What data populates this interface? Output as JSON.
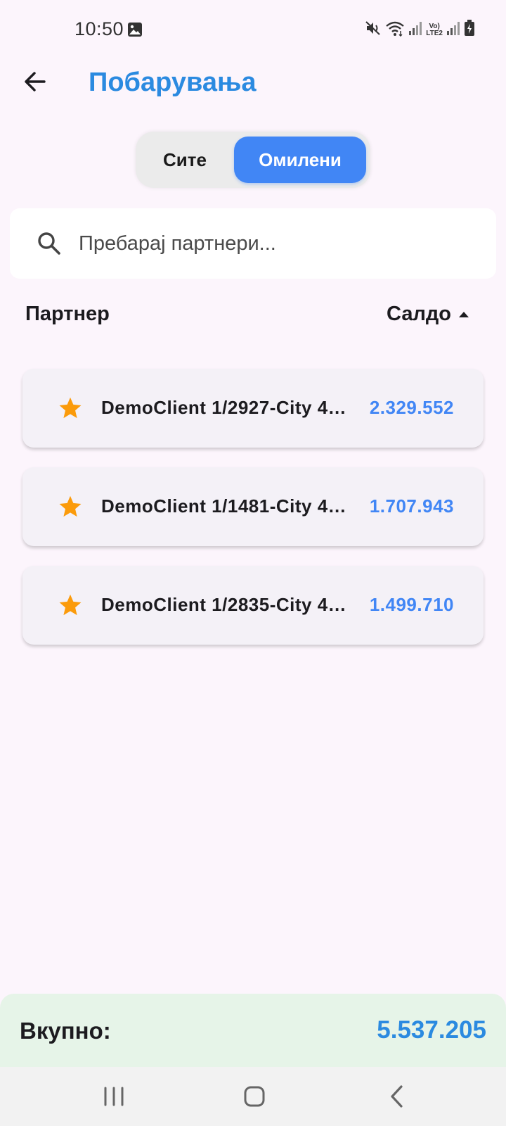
{
  "status_bar": {
    "time": "10:50",
    "volte_line1": "Vo)",
    "volte_line2": "LTE2"
  },
  "header": {
    "title": "Побарувања"
  },
  "filter_toggle": {
    "all_label": "Сите",
    "favorites_label": "Омилени",
    "selected": "favorites",
    "accent_color": "#4186f5"
  },
  "search": {
    "placeholder": "Пребарај партнери...",
    "value": ""
  },
  "columns": {
    "partner": "Партнер",
    "balance": "Салдо",
    "sort_icon": "sort-ascending-icon"
  },
  "partners": [
    {
      "name": "DemoClient 1/2927-City 4…",
      "balance": "2.329.552",
      "favorite": true
    },
    {
      "name": "DemoClient 1/1481-City 4…",
      "balance": "1.707.943",
      "favorite": true
    },
    {
      "name": "DemoClient 1/2835-City 4…",
      "balance": "1.499.710",
      "favorite": true
    }
  ],
  "total": {
    "label": "Вкупно:",
    "value": "5.537.205"
  },
  "colors": {
    "title": "#2b8ae0",
    "star": "#fb9b0b",
    "balance": "#4186f5",
    "total_bg": "#e6f4e8"
  }
}
